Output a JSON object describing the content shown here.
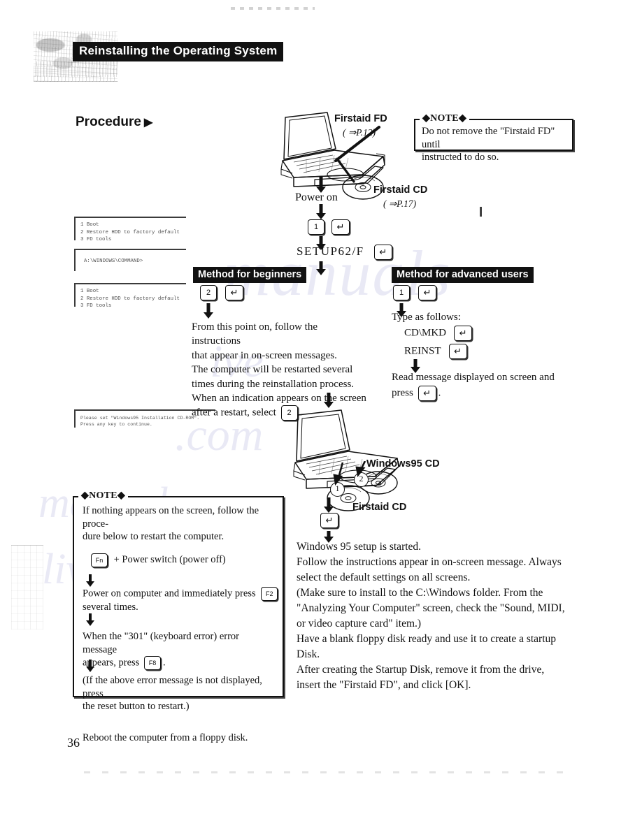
{
  "header": {
    "section_title": "Reinstalling the Operating System"
  },
  "procedure": {
    "heading": "Procedure",
    "arrow_glyph": "▶"
  },
  "illustration_top": {
    "firstaid_fd_label": "Firstaid FD",
    "firstaid_fd_ref": "( ⇒P.12)",
    "firstaid_cd_label": "Firstaid CD",
    "firstaid_cd_ref": "( ⇒P.17)",
    "power_on_label": "Power on"
  },
  "note_top": {
    "tag": "◆NOTE◆",
    "lines": [
      "Do not remove the \"Firstaid FD\" until",
      "instructed to do so."
    ]
  },
  "terminals": {
    "menu_first": [
      "1 Boot",
      "2 Restore HDD to factory default",
      "3 FD tools"
    ],
    "prompt": [
      "A:\\WINDOWS\\COMMAND>"
    ],
    "menu_second": [
      "1 Boot",
      "2 Restore HDD to factory default",
      "3 FD tools"
    ],
    "cd_prompt": [
      "Please set \"Windows95 Installation CD-ROM\".",
      "Press any key to continue."
    ]
  },
  "center_flow": {
    "key_1": "1",
    "key_enter": "↵",
    "setup_command": "SETUP62/F"
  },
  "beginners": {
    "label": "Method for beginners",
    "key_2": "2",
    "key_enter": "↵",
    "lines": [
      "From this point on, follow the instructions",
      "that appear in on-screen messages.",
      "The computer will be restarted several",
      "times during the reinstallation process.",
      "When an indication appears on the screen"
    ],
    "last_line_prefix": "after a restart, select",
    "last_line_key": "2",
    "last_line_suffix": "."
  },
  "advanced": {
    "label": "Method for advanced users",
    "key_1": "1",
    "key_enter": "↵",
    "type_as_follows": "Type as follows:",
    "cmd_1": "CD\\MKD",
    "cmd_2": "REINST",
    "read_message": "Read message displayed on screen and",
    "press_prefix": "press",
    "press_suffix": "."
  },
  "illustration_bottom": {
    "windows95_cd_label": "Windows95 CD",
    "firstaid_cd_label": "Firstaid CD",
    "marker_1": "1",
    "marker_2": "2",
    "key_enter": "↵"
  },
  "note_bottom": {
    "tag": "◆NOTE◆",
    "intro": [
      "If nothing appears on the screen, follow the proce-",
      "dure below to restart the computer."
    ],
    "step1_key": "Fn",
    "step1_text": "+ Power switch (power off)",
    "step2_prefix": "Power on computer and immediately press",
    "step2_key": "F2",
    "step2_suffix": "several times.",
    "step3_line1": "When the \"301\" (keyboard error) error message",
    "step3_prefix": "appears, press",
    "step3_key": "F8",
    "step3_suffix": ".",
    "step3_paren": [
      "(If the above error message is not displayed, press",
      "the reset button to restart.)"
    ],
    "step4_text": "Reboot the computer from a floppy disk."
  },
  "final_text": {
    "lines": [
      "Windows 95 setup is started.",
      "Follow the instructions appear in on-screen message. Always",
      "select the default settings on all screens.",
      "(Make sure to install to the C:\\Windows folder. From the",
      "\"Analyzing Your Computer\" screen, check the \"Sound, MIDI,",
      "or video capture card\" item.)",
      "Have a blank floppy disk ready and use it to create a startup",
      "Disk.",
      "After creating the Startup Disk, remove it from the drive,",
      "insert the \"Firstaid FD\", and click [OK]."
    ]
  },
  "footer": {
    "page_number": "36"
  },
  "watermark": {
    "l1": "manuals",
    "l2": "ive",
    "l3": ".com",
    "l4": "manuals",
    "l5": "live"
  }
}
